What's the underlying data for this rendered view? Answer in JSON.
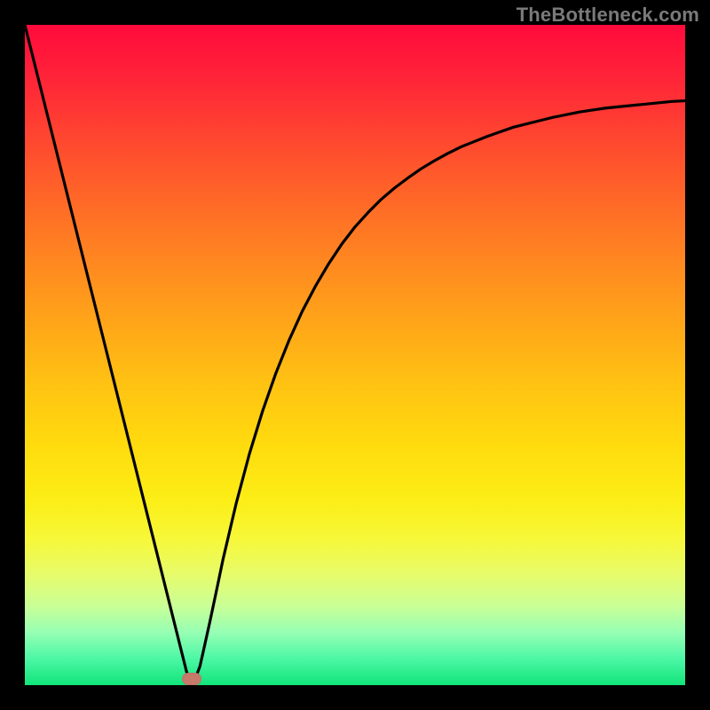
{
  "watermark": "TheBottleneck.com",
  "colors": {
    "curve": "#000000",
    "marker": "#c67a6a"
  },
  "chart_data": {
    "type": "line",
    "title": "",
    "xlabel": "",
    "ylabel": "",
    "xlim": [
      0,
      1
    ],
    "ylim": [
      0,
      1
    ],
    "grid": false,
    "legend": false,
    "x": [
      0.0,
      0.02,
      0.04,
      0.06,
      0.08,
      0.1,
      0.12,
      0.14,
      0.16,
      0.18,
      0.2,
      0.22,
      0.24,
      0.245,
      0.25,
      0.255,
      0.26,
      0.265,
      0.27,
      0.28,
      0.29,
      0.3,
      0.32,
      0.34,
      0.36,
      0.38,
      0.4,
      0.42,
      0.44,
      0.46,
      0.48,
      0.5,
      0.52,
      0.54,
      0.56,
      0.58,
      0.6,
      0.62,
      0.64,
      0.66,
      0.68,
      0.7,
      0.72,
      0.74,
      0.76,
      0.78,
      0.8,
      0.82,
      0.84,
      0.86,
      0.88,
      0.9,
      0.92,
      0.94,
      0.96,
      0.98,
      1.0
    ],
    "values": [
      1.0,
      0.92,
      0.84,
      0.76,
      0.68,
      0.6,
      0.52,
      0.44,
      0.36,
      0.28,
      0.2,
      0.12,
      0.04,
      0.02,
      0.01,
      0.01,
      0.015,
      0.028,
      0.05,
      0.095,
      0.142,
      0.19,
      0.275,
      0.35,
      0.415,
      0.472,
      0.522,
      0.566,
      0.604,
      0.638,
      0.668,
      0.694,
      0.716,
      0.736,
      0.753,
      0.768,
      0.782,
      0.794,
      0.805,
      0.815,
      0.823,
      0.831,
      0.838,
      0.845,
      0.85,
      0.855,
      0.86,
      0.864,
      0.868,
      0.871,
      0.874,
      0.876,
      0.878,
      0.88,
      0.882,
      0.884,
      0.885
    ],
    "marker": {
      "x": 0.253,
      "y": 0.01
    },
    "notes": "x and y are normalized 0–1: x is horizontal position across the plot, y is vertical height (0=bottom/green, 1=top/red). The curve is |f(x)| shaped with a sharp minimum near x≈0.25; left branch is roughly linear descending, right branch rises with diminishing slope toward ~0.885."
  }
}
